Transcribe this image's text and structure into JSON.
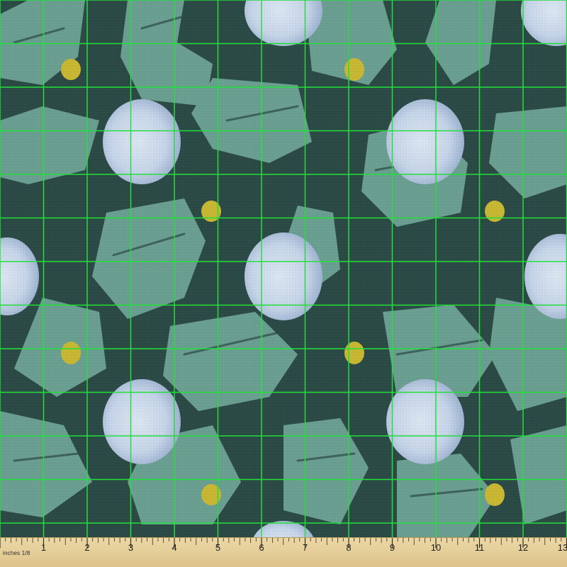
{
  "pattern": {
    "name": "abstract brush-stroke polka dot fabric swatch",
    "colors": {
      "background_dark": "#2b4a45",
      "brush_light": "#6a9e90",
      "dot_white": "#c9d7e8",
      "dot_shadow": "#8fa6c7",
      "dot_yellow": "#c7b733",
      "grid_line": "#22e03a"
    }
  },
  "ruler": {
    "unit_label": "inches 1/8",
    "numbers": [
      "1",
      "2",
      "3",
      "4",
      "5",
      "6",
      "7",
      "8",
      "9",
      "10",
      "11",
      "12",
      "13"
    ]
  }
}
